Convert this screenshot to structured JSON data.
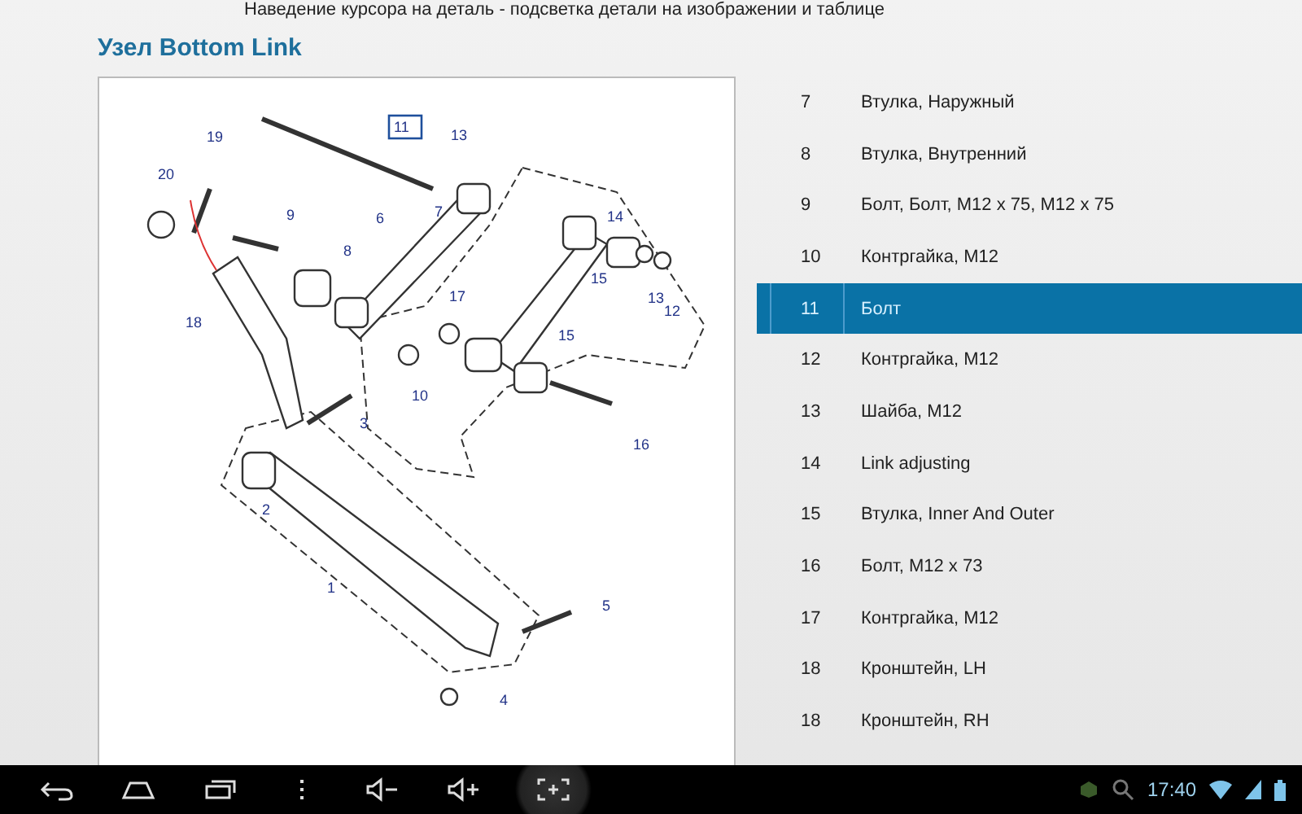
{
  "hint": "Наведение курсора на деталь - подсветка детали на изображении и таблице",
  "title": "Узел Bottom Link",
  "callouts": [
    {
      "label": "11",
      "selected": true
    },
    {
      "label": "13",
      "selected": false
    },
    {
      "label": "19",
      "selected": false
    },
    {
      "label": "20",
      "selected": false
    },
    {
      "label": "9",
      "selected": false
    },
    {
      "label": "6",
      "selected": false
    },
    {
      "label": "7",
      "selected": false
    },
    {
      "label": "14",
      "selected": false
    },
    {
      "label": "8",
      "selected": false
    },
    {
      "label": "15",
      "selected": false
    },
    {
      "label": "13",
      "selected": false
    },
    {
      "label": "12",
      "selected": false
    },
    {
      "label": "18",
      "selected": false
    },
    {
      "label": "17",
      "selected": false
    },
    {
      "label": "15",
      "selected": false
    },
    {
      "label": "10",
      "selected": false
    },
    {
      "label": "3",
      "selected": false
    },
    {
      "label": "16",
      "selected": false
    },
    {
      "label": "2",
      "selected": false
    },
    {
      "label": "1",
      "selected": false
    },
    {
      "label": "5",
      "selected": false
    },
    {
      "label": "4",
      "selected": false
    }
  ],
  "parts": [
    {
      "number": "7",
      "name": "Втулка, Наружный",
      "selected": false
    },
    {
      "number": "8",
      "name": "Втулка, Внутренний",
      "selected": false
    },
    {
      "number": "9",
      "name": "Болт, Болт, M12 x 75, M12 x 75",
      "selected": false
    },
    {
      "number": "10",
      "name": "Контргайка, M12",
      "selected": false
    },
    {
      "number": "11",
      "name": "Болт",
      "selected": true
    },
    {
      "number": "12",
      "name": "Контргайка, M12",
      "selected": false
    },
    {
      "number": "13",
      "name": "Шайба, M12",
      "selected": false
    },
    {
      "number": "14",
      "name": "Link adjusting",
      "selected": false
    },
    {
      "number": "15",
      "name": "Втулка, Inner And Outer",
      "selected": false
    },
    {
      "number": "16",
      "name": "Болт, M12 x 73",
      "selected": false
    },
    {
      "number": "17",
      "name": "Контргайка, M12",
      "selected": false
    },
    {
      "number": "18",
      "name": "Кронштейн, LH",
      "selected": false
    },
    {
      "number": "18",
      "name": "Кронштейн, RH",
      "selected": false
    }
  ],
  "status": {
    "time": "17:40"
  }
}
